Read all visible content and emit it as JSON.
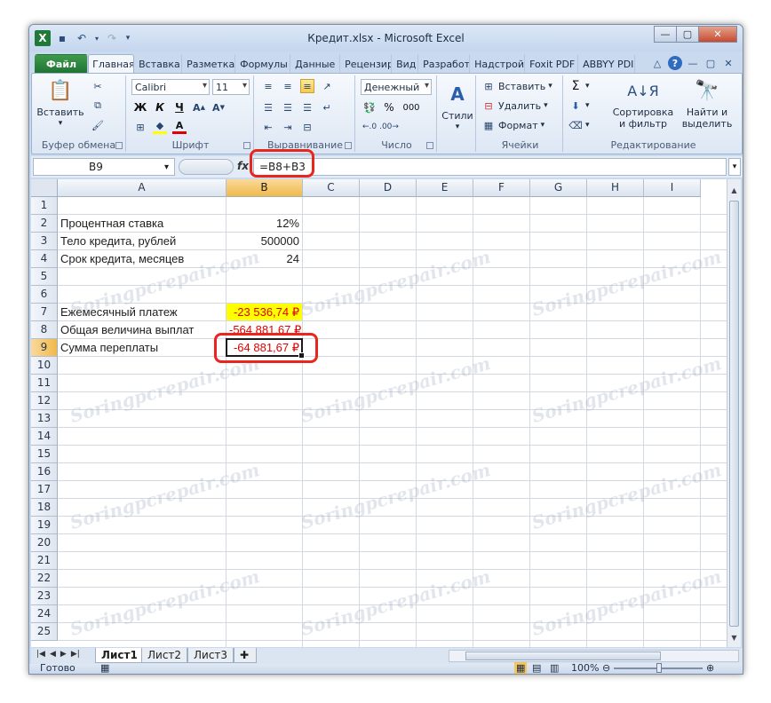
{
  "window": {
    "title": "Кредит.xlsx - Microsoft Excel"
  },
  "tabs": [
    "Файл",
    "Главная",
    "Вставка",
    "Разметка",
    "Формулы",
    "Данные",
    "Рецензир",
    "Вид",
    "Разработ",
    "Надстрой",
    "Foxit PDF",
    "ABBYY PDI"
  ],
  "ribbon": {
    "clipboard": {
      "paste": "Вставить",
      "label": "Буфер обмена"
    },
    "font": {
      "name": "Calibri",
      "size": "11",
      "bold": "Ж",
      "italic": "К",
      "underline": "Ч",
      "color_letter": "А",
      "label": "Шрифт"
    },
    "alignment": {
      "label": "Выравнивание"
    },
    "number": {
      "format": "Денежный",
      "percent": "%",
      "thousands": "000",
      "label": "Число"
    },
    "styles": {
      "label": "Стили"
    },
    "cells": {
      "insert": "Вставить",
      "delete": "Удалить",
      "format": "Формат",
      "label": "Ячейки"
    },
    "editing": {
      "sigma": "Σ",
      "sort": "Сортировка",
      "sort2": "и фильтр",
      "find": "Найти и",
      "find2": "выделить",
      "label": "Редактирование"
    }
  },
  "formula_bar": {
    "name_box": "B9",
    "fx": "fx",
    "formula": "=B8+B3"
  },
  "columns": [
    "A",
    "B",
    "C",
    "D",
    "E",
    "F",
    "G",
    "H",
    "I"
  ],
  "rows": [
    "1",
    "2",
    "3",
    "4",
    "5",
    "6",
    "7",
    "8",
    "9",
    "10",
    "11",
    "12",
    "13",
    "14",
    "15",
    "16",
    "17",
    "18",
    "19",
    "20",
    "21",
    "22",
    "23",
    "24",
    "25"
  ],
  "cells": {
    "A2": "Процентная ставка",
    "B2": "12%",
    "A3": "Тело кредита, рублей",
    "B3": "500000",
    "A4": "Срок кредита, месяцев",
    "B4": "24",
    "A7": "Ежемесячный платеж",
    "B7": "-23 536,74 ₽",
    "A8": "Общая величина выплат",
    "B8": "-564 881,67 ₽",
    "A9": "Сумма переплаты",
    "B9": "-64 881,67 ₽"
  },
  "sheets": [
    "Лист1",
    "Лист2",
    "Лист3"
  ],
  "status": {
    "ready": "Готово",
    "zoom": "100%"
  },
  "watermark": "Soringpcrepair.com",
  "colors": {
    "accent": "#1f7a3a",
    "negative": "#e00000",
    "highlight": "#ffff00",
    "callout": "#e8261d"
  }
}
